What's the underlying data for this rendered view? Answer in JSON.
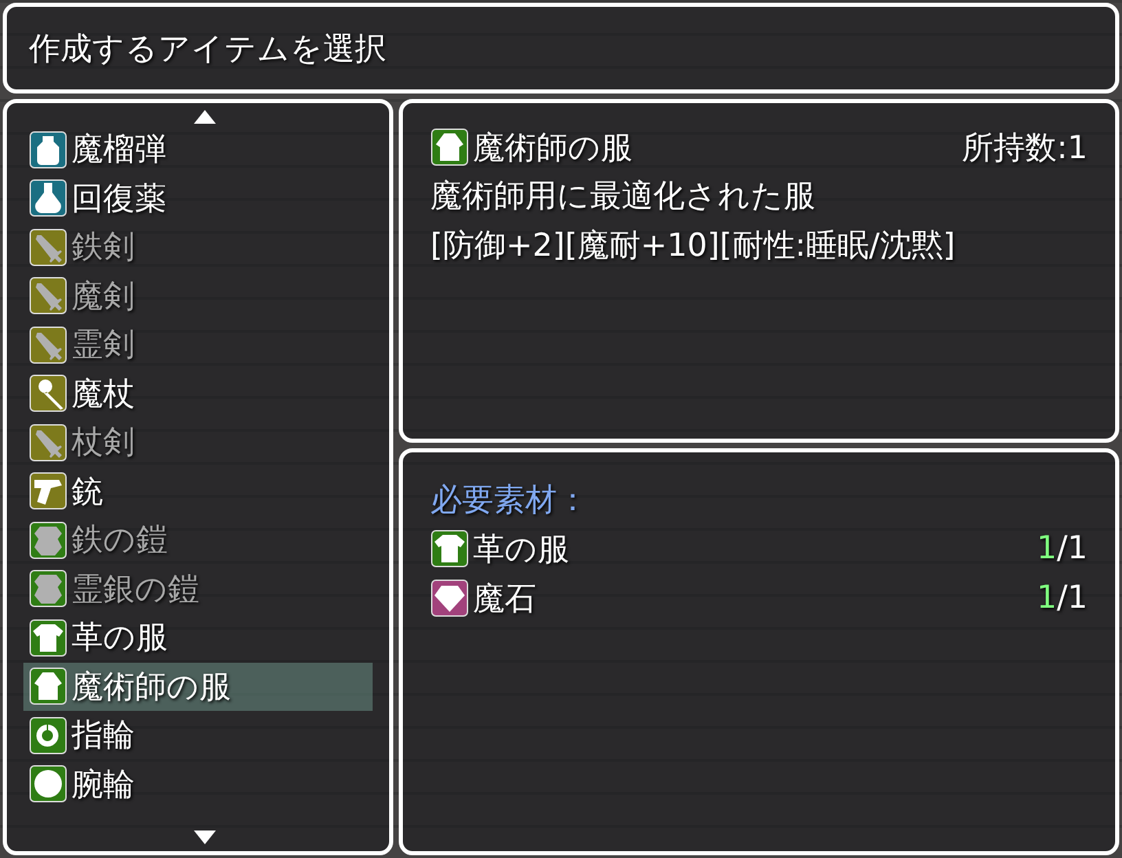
{
  "help_window": {
    "text": "作成するアイテムを選択"
  },
  "item_list": {
    "scroll_up": true,
    "scroll_down": true,
    "items": [
      {
        "name": "魔榴弾",
        "kind": "bomb",
        "color": "#1b6f82",
        "disabled": false,
        "selected": false
      },
      {
        "name": "回復薬",
        "kind": "potion",
        "color": "#1b6f82",
        "disabled": false,
        "selected": false
      },
      {
        "name": "鉄剣",
        "kind": "sword",
        "color": "#7d7a1c",
        "disabled": true,
        "selected": false
      },
      {
        "name": "魔剣",
        "kind": "sword",
        "color": "#7d7a1c",
        "disabled": true,
        "selected": false
      },
      {
        "name": "霊剣",
        "kind": "sword",
        "color": "#7d7a1c",
        "disabled": true,
        "selected": false
      },
      {
        "name": "魔杖",
        "kind": "staff",
        "color": "#7d7a1c",
        "disabled": false,
        "selected": false
      },
      {
        "name": "杖剣",
        "kind": "sword",
        "color": "#7d7a1c",
        "disabled": true,
        "selected": false
      },
      {
        "name": "銃",
        "kind": "gun",
        "color": "#7d7a1c",
        "disabled": false,
        "selected": false
      },
      {
        "name": "鉄の鎧",
        "kind": "armor",
        "color": "#2f7d14",
        "disabled": true,
        "selected": false
      },
      {
        "name": "霊銀の鎧",
        "kind": "armor",
        "color": "#2f7d14",
        "disabled": true,
        "selected": false
      },
      {
        "name": "革の服",
        "kind": "shirt",
        "color": "#2f7d14",
        "disabled": false,
        "selected": false
      },
      {
        "name": "魔術師の服",
        "kind": "robe",
        "color": "#2f7d14",
        "disabled": false,
        "selected": true
      },
      {
        "name": "指輪",
        "kind": "ring",
        "color": "#2f7d14",
        "disabled": false,
        "selected": false
      },
      {
        "name": "腕輪",
        "kind": "bracelet",
        "color": "#2f7d14",
        "disabled": false,
        "selected": false
      }
    ]
  },
  "detail": {
    "name": "魔術師の服",
    "kind": "robe",
    "color": "#2f7d14",
    "owned_label": "所持数:1",
    "description": "魔術師用に最適化された服",
    "effects": "[防御+2][魔耐+10][耐性:睡眠/沈黙]"
  },
  "materials": {
    "heading": "必要素材：",
    "items": [
      {
        "name": "革の服",
        "kind": "shirt",
        "color": "#2f7d14",
        "have": "1",
        "need": "/1"
      },
      {
        "name": "魔石",
        "kind": "gem",
        "color": "#a2427c",
        "have": "1",
        "need": "/1"
      }
    ]
  }
}
